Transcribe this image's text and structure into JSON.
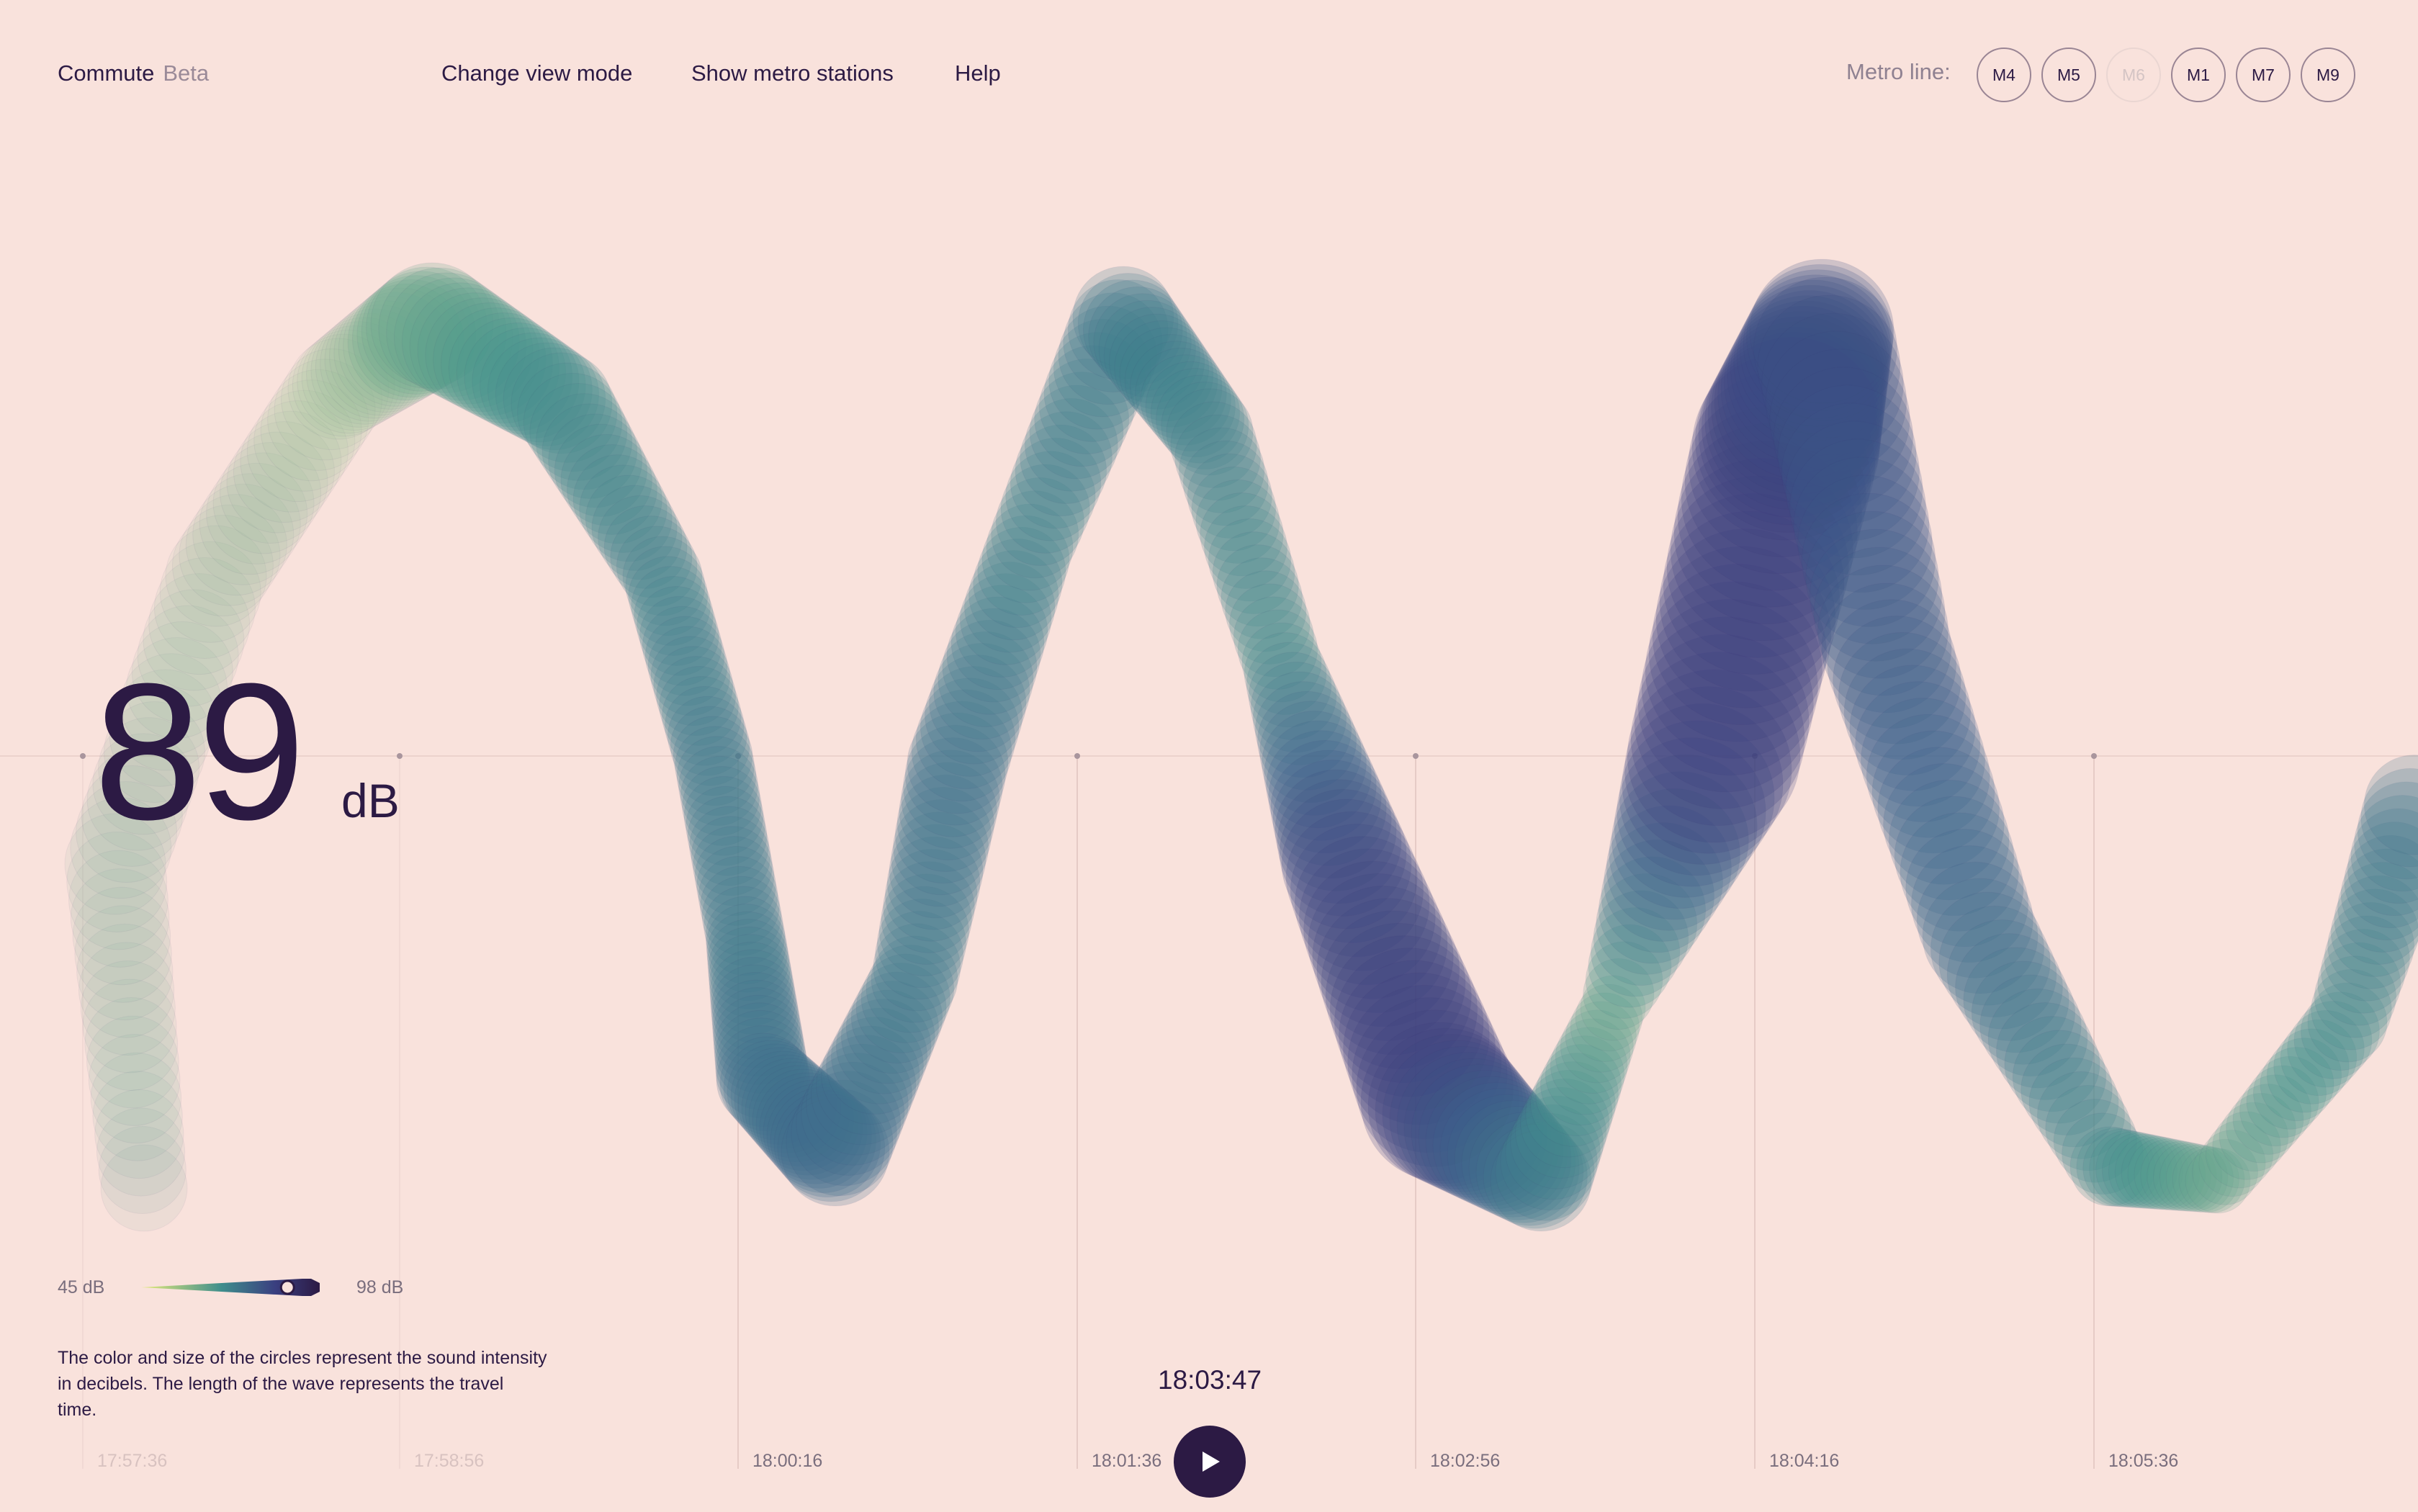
{
  "app": {
    "name": "Commute",
    "badge": "Beta"
  },
  "nav": [
    "Change view mode",
    "Show metro stations",
    "Help"
  ],
  "metro": {
    "label": "Metro line:",
    "lines": [
      {
        "label": "M4",
        "enabled": true
      },
      {
        "label": "M5",
        "enabled": true
      },
      {
        "label": "M6",
        "enabled": false
      },
      {
        "label": "M1",
        "enabled": true
      },
      {
        "label": "M7",
        "enabled": true
      },
      {
        "label": "M9",
        "enabled": true
      }
    ]
  },
  "readout": {
    "value": "89",
    "unit": "dB"
  },
  "scale": {
    "min_label": "45 dB",
    "max_label": "98 dB",
    "min": 45,
    "max": 98,
    "current": 89
  },
  "legend": "The color and size of the circles represent the sound intensity in decibels. The length of the wave represents the travel time.",
  "playback": {
    "current_time": "18:03:47",
    "icon": "play-icon"
  },
  "timeline": {
    "ticks": [
      "17:57:36",
      "17:58:56",
      "18:00:16",
      "18:01:36",
      "18:02:56",
      "18:04:16",
      "18:05:36"
    ],
    "faded": [
      true,
      true,
      false,
      false,
      false,
      false,
      false
    ]
  },
  "colors": {
    "background": "#f9e2dc",
    "text": "#2c1a44",
    "low_db": "#c7e27a",
    "mid_db": "#3f8e8c",
    "high_db": "#3d2a78"
  }
}
